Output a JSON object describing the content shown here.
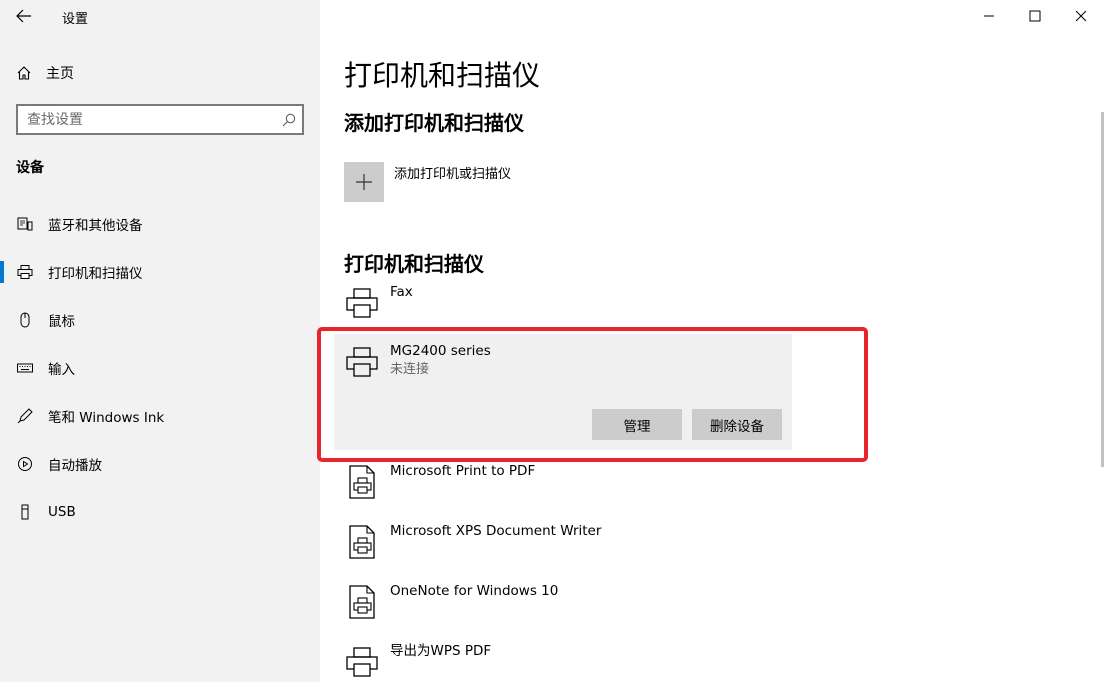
{
  "window": {
    "title": "设置"
  },
  "sidebar": {
    "home_label": "主页",
    "search": {
      "placeholder": "查找设置"
    },
    "section_title": "设备",
    "items": [
      {
        "label": "蓝牙和其他设备",
        "icon": "bluetooth-devices-icon",
        "active": false
      },
      {
        "label": "打印机和扫描仪",
        "icon": "printer-icon",
        "active": true
      },
      {
        "label": "鼠标",
        "icon": "mouse-icon",
        "active": false
      },
      {
        "label": "输入",
        "icon": "keyboard-icon",
        "active": false
      },
      {
        "label": "笔和 Windows Ink",
        "icon": "pen-icon",
        "active": false
      },
      {
        "label": "自动播放",
        "icon": "autoplay-icon",
        "active": false
      },
      {
        "label": "USB",
        "icon": "usb-icon",
        "active": false
      }
    ]
  },
  "main": {
    "title": "打印机和扫描仪",
    "add_section_title": "添加打印机和扫描仪",
    "add_label": "添加打印机或扫描仪",
    "devices_section_title": "打印机和扫描仪",
    "devices": [
      {
        "name": "Fax",
        "status": "",
        "icon": "printer-icon"
      },
      {
        "name": "MG2400 series",
        "status": "未连接",
        "icon": "printer-icon",
        "selected": true
      },
      {
        "name": "Microsoft Print to PDF",
        "status": "",
        "icon": "document-printer-icon"
      },
      {
        "name": "Microsoft XPS Document Writer",
        "status": "",
        "icon": "document-printer-icon"
      },
      {
        "name": "OneNote for Windows 10",
        "status": "",
        "icon": "document-printer-icon"
      },
      {
        "name": "导出为WPS PDF",
        "status": "",
        "icon": "printer-icon"
      }
    ],
    "selected_actions": {
      "manage_label": "管理",
      "remove_label": "删除设备"
    }
  },
  "colors": {
    "accent": "#0078d4",
    "highlight": "#e8252a",
    "sidebar_bg": "#f2f2f2",
    "tile_bg": "#cccccc"
  }
}
